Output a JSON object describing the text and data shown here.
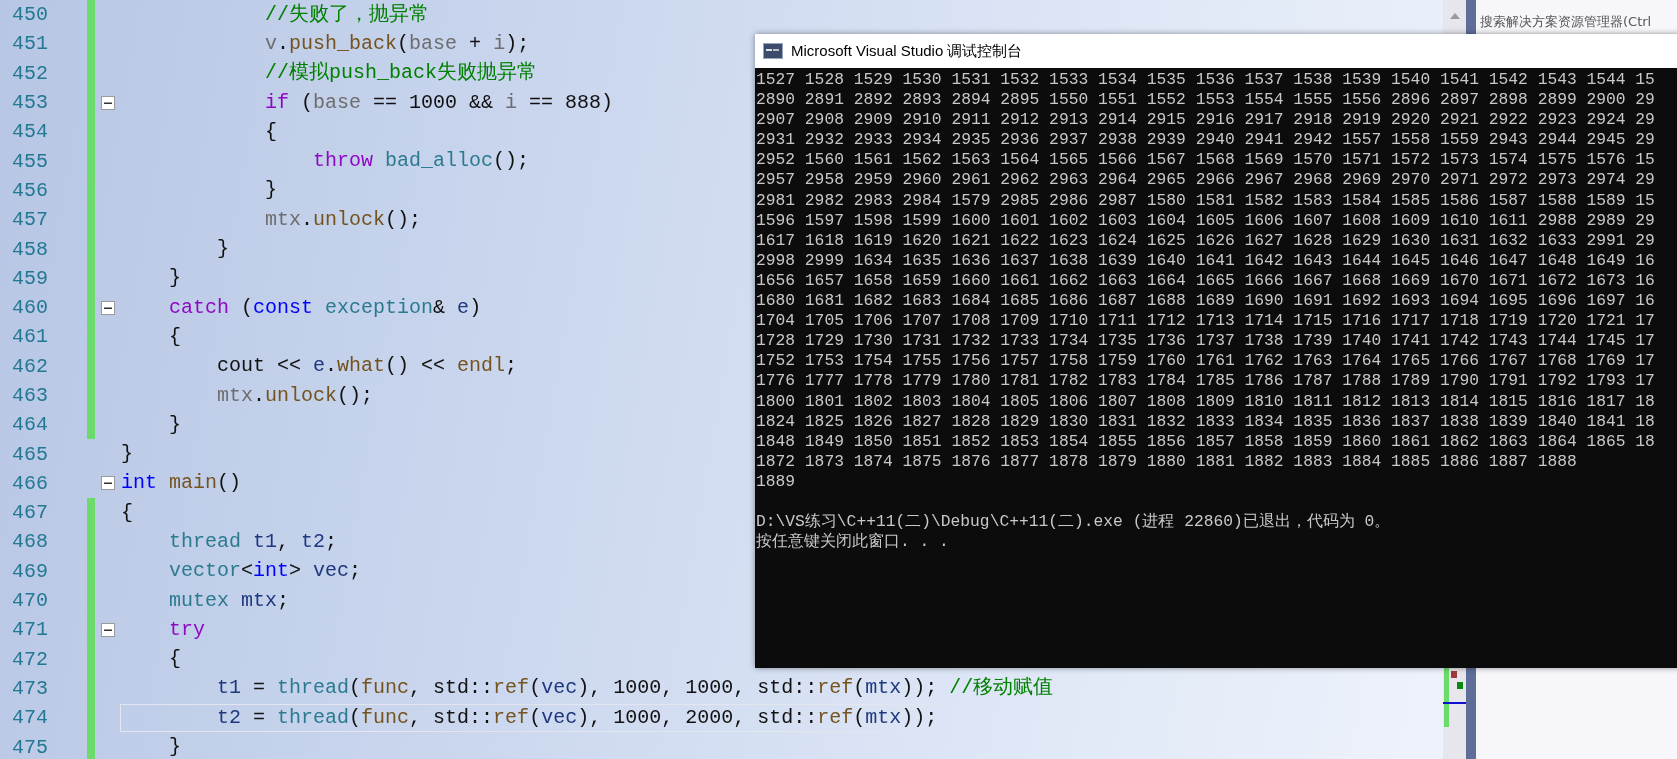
{
  "editor": {
    "lines": [
      {
        "number": "450",
        "changed": true,
        "fold": false,
        "current": false,
        "tokens": [
          {
            "kind": "comment",
            "text": "            //失败了，抛异常"
          }
        ]
      },
      {
        "number": "451",
        "changed": true,
        "fold": false,
        "current": false,
        "tokens": [
          {
            "kind": "param",
            "text": "            v"
          },
          {
            "kind": "plain",
            "text": "."
          },
          {
            "kind": "func",
            "text": "push_back"
          },
          {
            "kind": "plain",
            "text": "("
          },
          {
            "kind": "param",
            "text": "base"
          },
          {
            "kind": "plain",
            "text": " + "
          },
          {
            "kind": "param",
            "text": "i"
          },
          {
            "kind": "plain",
            "text": ");"
          }
        ]
      },
      {
        "number": "452",
        "changed": true,
        "fold": false,
        "current": false,
        "tokens": [
          {
            "kind": "comment",
            "text": "            //模拟push_back失败抛异常"
          }
        ]
      },
      {
        "number": "453",
        "changed": true,
        "fold": true,
        "current": false,
        "tokens": [
          {
            "kind": "keyword",
            "text": "            if"
          },
          {
            "kind": "plain",
            "text": " ("
          },
          {
            "kind": "param",
            "text": "base"
          },
          {
            "kind": "plain",
            "text": " == 1000 && "
          },
          {
            "kind": "param",
            "text": "i"
          },
          {
            "kind": "plain",
            "text": " == 888)"
          }
        ]
      },
      {
        "number": "454",
        "changed": true,
        "fold": false,
        "current": false,
        "tokens": [
          {
            "kind": "plain",
            "text": "            {"
          }
        ]
      },
      {
        "number": "455",
        "changed": true,
        "fold": false,
        "current": false,
        "tokens": [
          {
            "kind": "keyword",
            "text": "                throw"
          },
          {
            "kind": "class",
            "text": " bad_alloc"
          },
          {
            "kind": "plain",
            "text": "();"
          }
        ]
      },
      {
        "number": "456",
        "changed": true,
        "fold": false,
        "current": false,
        "tokens": [
          {
            "kind": "plain",
            "text": "            }"
          }
        ]
      },
      {
        "number": "457",
        "changed": true,
        "fold": false,
        "current": false,
        "tokens": [
          {
            "kind": "param",
            "text": "            mtx"
          },
          {
            "kind": "plain",
            "text": "."
          },
          {
            "kind": "func",
            "text": "unlock"
          },
          {
            "kind": "plain",
            "text": "();"
          }
        ]
      },
      {
        "number": "458",
        "changed": true,
        "fold": false,
        "current": false,
        "tokens": [
          {
            "kind": "plain",
            "text": "        }"
          }
        ]
      },
      {
        "number": "459",
        "changed": true,
        "fold": false,
        "current": false,
        "tokens": [
          {
            "kind": "plain",
            "text": "    }"
          }
        ]
      },
      {
        "number": "460",
        "changed": true,
        "fold": true,
        "current": false,
        "tokens": [
          {
            "kind": "keyword",
            "text": "    catch"
          },
          {
            "kind": "plain",
            "text": " ("
          },
          {
            "kind": "type",
            "text": "const"
          },
          {
            "kind": "class",
            "text": " exception"
          },
          {
            "kind": "plain",
            "text": "& "
          },
          {
            "kind": "local",
            "text": "e"
          },
          {
            "kind": "plain",
            "text": ")"
          }
        ]
      },
      {
        "number": "461",
        "changed": true,
        "fold": false,
        "current": false,
        "tokens": [
          {
            "kind": "plain",
            "text": "    {"
          }
        ]
      },
      {
        "number": "462",
        "changed": true,
        "fold": false,
        "current": false,
        "tokens": [
          {
            "kind": "plain",
            "text": "        cout << "
          },
          {
            "kind": "local",
            "text": "e"
          },
          {
            "kind": "plain",
            "text": "."
          },
          {
            "kind": "func",
            "text": "what"
          },
          {
            "kind": "plain",
            "text": "() << "
          },
          {
            "kind": "func",
            "text": "endl"
          },
          {
            "kind": "plain",
            "text": ";"
          }
        ]
      },
      {
        "number": "463",
        "changed": true,
        "fold": false,
        "current": false,
        "tokens": [
          {
            "kind": "param",
            "text": "        mtx"
          },
          {
            "kind": "plain",
            "text": "."
          },
          {
            "kind": "func",
            "text": "unlock"
          },
          {
            "kind": "plain",
            "text": "();"
          }
        ]
      },
      {
        "number": "464",
        "changed": true,
        "fold": false,
        "current": false,
        "tokens": [
          {
            "kind": "plain",
            "text": "    }"
          }
        ]
      },
      {
        "number": "465",
        "changed": false,
        "fold": false,
        "current": false,
        "tokens": [
          {
            "kind": "plain",
            "text": "}"
          }
        ]
      },
      {
        "number": "466",
        "changed": false,
        "fold": true,
        "current": false,
        "tokens": [
          {
            "kind": "type",
            "text": "int"
          },
          {
            "kind": "func",
            "text": " main"
          },
          {
            "kind": "plain",
            "text": "()"
          }
        ]
      },
      {
        "number": "467",
        "changed": true,
        "fold": false,
        "current": false,
        "tokens": [
          {
            "kind": "plain",
            "text": "{"
          }
        ]
      },
      {
        "number": "468",
        "changed": true,
        "fold": false,
        "current": false,
        "tokens": [
          {
            "kind": "class",
            "text": "    thread"
          },
          {
            "kind": "local",
            "text": " t1"
          },
          {
            "kind": "plain",
            "text": ", "
          },
          {
            "kind": "local",
            "text": "t2"
          },
          {
            "kind": "plain",
            "text": ";"
          }
        ]
      },
      {
        "number": "469",
        "changed": true,
        "fold": false,
        "current": false,
        "tokens": [
          {
            "kind": "class",
            "text": "    vector"
          },
          {
            "kind": "plain",
            "text": "<"
          },
          {
            "kind": "type",
            "text": "int"
          },
          {
            "kind": "plain",
            "text": "> "
          },
          {
            "kind": "local",
            "text": "vec"
          },
          {
            "kind": "plain",
            "text": ";"
          }
        ]
      },
      {
        "number": "470",
        "changed": true,
        "fold": false,
        "current": false,
        "tokens": [
          {
            "kind": "class",
            "text": "    mutex"
          },
          {
            "kind": "local",
            "text": " mtx"
          },
          {
            "kind": "plain",
            "text": ";"
          }
        ]
      },
      {
        "number": "471",
        "changed": true,
        "fold": true,
        "current": false,
        "tokens": [
          {
            "kind": "keyword",
            "text": "    try"
          }
        ]
      },
      {
        "number": "472",
        "changed": true,
        "fold": false,
        "current": false,
        "tokens": [
          {
            "kind": "plain",
            "text": "    {"
          }
        ]
      },
      {
        "number": "473",
        "changed": true,
        "fold": false,
        "current": false,
        "tokens": [
          {
            "kind": "local",
            "text": "        t1"
          },
          {
            "kind": "plain",
            "text": " = "
          },
          {
            "kind": "class",
            "text": "thread"
          },
          {
            "kind": "plain",
            "text": "("
          },
          {
            "kind": "func",
            "text": "func"
          },
          {
            "kind": "plain",
            "text": ", std::"
          },
          {
            "kind": "func",
            "text": "ref"
          },
          {
            "kind": "plain",
            "text": "("
          },
          {
            "kind": "local",
            "text": "vec"
          },
          {
            "kind": "plain",
            "text": "), 1000, 1000, std::"
          },
          {
            "kind": "func",
            "text": "ref"
          },
          {
            "kind": "plain",
            "text": "("
          },
          {
            "kind": "local",
            "text": "mtx"
          },
          {
            "kind": "plain",
            "text": ")); "
          },
          {
            "kind": "comment",
            "text": "//移动赋值"
          }
        ]
      },
      {
        "number": "474",
        "changed": true,
        "fold": false,
        "current": true,
        "tokens": [
          {
            "kind": "local",
            "text": "        t2"
          },
          {
            "kind": "plain",
            "text": " = "
          },
          {
            "kind": "class",
            "text": "thread"
          },
          {
            "kind": "plain",
            "text": "("
          },
          {
            "kind": "func",
            "text": "func"
          },
          {
            "kind": "plain",
            "text": ", std::"
          },
          {
            "kind": "func",
            "text": "ref"
          },
          {
            "kind": "plain",
            "text": "("
          },
          {
            "kind": "local",
            "text": "vec"
          },
          {
            "kind": "plain",
            "text": "), 1000, 2000, std::"
          },
          {
            "kind": "func",
            "text": "ref"
          },
          {
            "kind": "plain",
            "text": "("
          },
          {
            "kind": "local",
            "text": "mtx"
          },
          {
            "kind": "plain",
            "text": "));"
          }
        ]
      },
      {
        "number": "475",
        "changed": true,
        "fold": false,
        "current": false,
        "tokens": [
          {
            "kind": "plain",
            "text": "    }"
          }
        ]
      }
    ]
  },
  "solution_explorer": {
    "search_placeholder": "搜索解决方案资源管理器(Ctrl"
  },
  "console": {
    "title": "Microsoft Visual Studio 调试控制台",
    "lines": [
      "1527 1528 1529 1530 1531 1532 1533 1534 1535 1536 1537 1538 1539 1540 1541 1542 1543 1544 15",
      "2890 2891 2892 2893 2894 2895 1550 1551 1552 1553 1554 1555 1556 2896 2897 2898 2899 2900 29",
      "2907 2908 2909 2910 2911 2912 2913 2914 2915 2916 2917 2918 2919 2920 2921 2922 2923 2924 29",
      "2931 2932 2933 2934 2935 2936 2937 2938 2939 2940 2941 2942 1557 1558 1559 2943 2944 2945 29",
      "2952 1560 1561 1562 1563 1564 1565 1566 1567 1568 1569 1570 1571 1572 1573 1574 1575 1576 15",
      "2957 2958 2959 2960 2961 2962 2963 2964 2965 2966 2967 2968 2969 2970 2971 2972 2973 2974 29",
      "2981 2982 2983 2984 1579 2985 2986 2987 1580 1581 1582 1583 1584 1585 1586 1587 1588 1589 15",
      "1596 1597 1598 1599 1600 1601 1602 1603 1604 1605 1606 1607 1608 1609 1610 1611 2988 2989 29",
      "1617 1618 1619 1620 1621 1622 1623 1624 1625 1626 1627 1628 1629 1630 1631 1632 1633 2991 29",
      "2998 2999 1634 1635 1636 1637 1638 1639 1640 1641 1642 1643 1644 1645 1646 1647 1648 1649 16",
      "1656 1657 1658 1659 1660 1661 1662 1663 1664 1665 1666 1667 1668 1669 1670 1671 1672 1673 16",
      "1680 1681 1682 1683 1684 1685 1686 1687 1688 1689 1690 1691 1692 1693 1694 1695 1696 1697 16",
      "1704 1705 1706 1707 1708 1709 1710 1711 1712 1713 1714 1715 1716 1717 1718 1719 1720 1721 17",
      "1728 1729 1730 1731 1732 1733 1734 1735 1736 1737 1738 1739 1740 1741 1742 1743 1744 1745 17",
      "1752 1753 1754 1755 1756 1757 1758 1759 1760 1761 1762 1763 1764 1765 1766 1767 1768 1769 17",
      "1776 1777 1778 1779 1780 1781 1782 1783 1784 1785 1786 1787 1788 1789 1790 1791 1792 1793 17",
      "1800 1801 1802 1803 1804 1805 1806 1807 1808 1809 1810 1811 1812 1813 1814 1815 1816 1817 18",
      "1824 1825 1826 1827 1828 1829 1830 1831 1832 1833 1834 1835 1836 1837 1838 1839 1840 1841 18",
      "1848 1849 1850 1851 1852 1853 1854 1855 1856 1857 1858 1859 1860 1861 1862 1863 1864 1865 18",
      "1872 1873 1874 1875 1876 1877 1878 1879 1880 1881 1882 1883 1884 1885 1886 1887 1888",
      "1889"
    ],
    "exit_message": "D:\\VS练习\\C++11(二)\\Debug\\C++11(二).exe (进程 22860)已退出，代码为 0。",
    "prompt": "按任意键关闭此窗口. . ."
  }
}
